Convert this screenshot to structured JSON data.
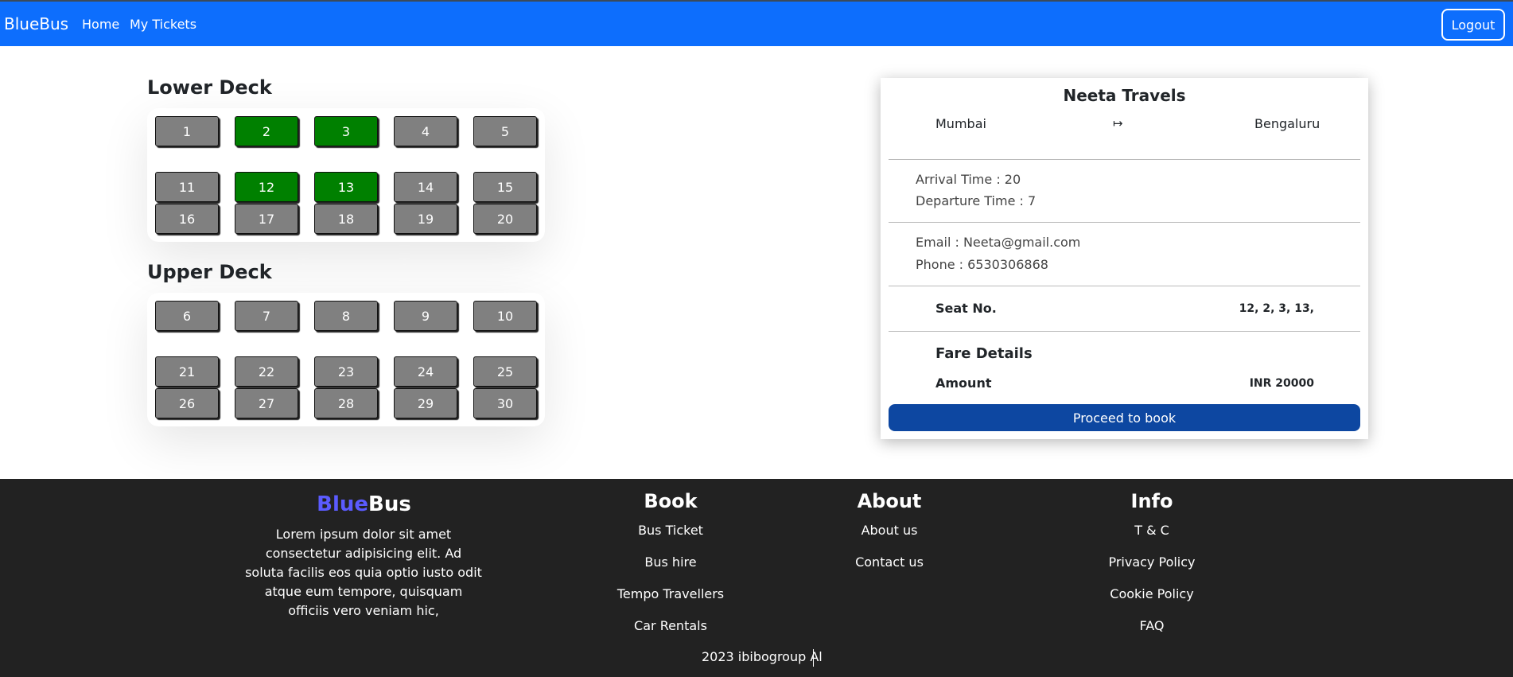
{
  "navbar": {
    "brand": "BlueBus",
    "home": "Home",
    "my_tickets": "My Tickets",
    "logout": "Logout"
  },
  "lower_deck": {
    "title": "Lower Deck",
    "rows": [
      [
        {
          "num": "1",
          "selected": false
        },
        {
          "num": "2",
          "selected": true
        },
        {
          "num": "3",
          "selected": true
        },
        {
          "num": "4",
          "selected": false
        },
        {
          "num": "5",
          "selected": false
        }
      ],
      [
        {
          "num": "11",
          "selected": false
        },
        {
          "num": "12",
          "selected": true
        },
        {
          "num": "13",
          "selected": true
        },
        {
          "num": "14",
          "selected": false
        },
        {
          "num": "15",
          "selected": false
        }
      ],
      [
        {
          "num": "16",
          "selected": false
        },
        {
          "num": "17",
          "selected": false
        },
        {
          "num": "18",
          "selected": false
        },
        {
          "num": "19",
          "selected": false
        },
        {
          "num": "20",
          "selected": false
        }
      ]
    ]
  },
  "upper_deck": {
    "title": "Upper Deck",
    "rows": [
      [
        {
          "num": "6",
          "selected": false
        },
        {
          "num": "7",
          "selected": false
        },
        {
          "num": "8",
          "selected": false
        },
        {
          "num": "9",
          "selected": false
        },
        {
          "num": "10",
          "selected": false
        }
      ],
      [
        {
          "num": "21",
          "selected": false
        },
        {
          "num": "22",
          "selected": false
        },
        {
          "num": "23",
          "selected": false
        },
        {
          "num": "24",
          "selected": false
        },
        {
          "num": "25",
          "selected": false
        }
      ],
      [
        {
          "num": "26",
          "selected": false
        },
        {
          "num": "27",
          "selected": false
        },
        {
          "num": "28",
          "selected": false
        },
        {
          "num": "29",
          "selected": false
        },
        {
          "num": "30",
          "selected": false
        }
      ]
    ]
  },
  "colors": {
    "seat_available": "#808080",
    "seat_selected": "#008000",
    "navbar": "#0d6efd",
    "proceed_button": "#0d47a1"
  },
  "booking": {
    "operator": "Neeta Travels",
    "from": "Mumbai",
    "arrow": "↦",
    "to": "Bengaluru",
    "arrival": "Arrival Time : 20",
    "departure": "Departure Time : 7",
    "email": "Email : Neeta@gmail.com",
    "phone": "Phone : 6530306868",
    "seat_label": "Seat No.",
    "seat_value": "12, 2, 3, 13,",
    "fare_title": "Fare Details",
    "amount_label": "Amount",
    "amount_value": "INR 20000",
    "proceed": "Proceed to book"
  },
  "footer": {
    "brand_blue": "Blue",
    "brand_white": "Bus",
    "about_text": "Lorem ipsum dolor sit amet consectetur adipisicing elit. Ad soluta facilis eos quia optio iusto odit atque eum tempore, quisquam officiis vero veniam hic,",
    "book_title": "Book",
    "book_links": [
      "Bus Ticket",
      "Bus hire",
      "Tempo Travellers",
      "Car Rentals"
    ],
    "about_title": "About",
    "about_links": [
      "About us",
      "Contact us"
    ],
    "info_title": "Info",
    "info_links": [
      "T & C",
      "Privacy Policy",
      "Cookie Policy",
      "FAQ"
    ],
    "copyright": "2023 ibibogroup Al"
  }
}
